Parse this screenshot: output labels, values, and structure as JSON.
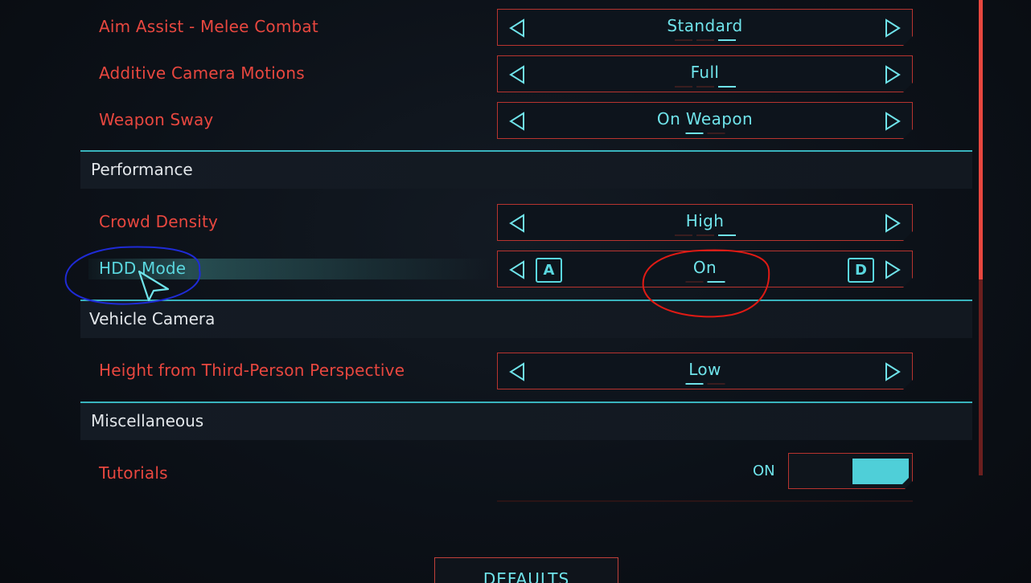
{
  "colors": {
    "label_red": "#e8473f",
    "value_cyan": "#6fe3ea",
    "section_line": "#39b3bd",
    "border_red": "#b8342f"
  },
  "rows": {
    "aim_assist": {
      "label": "Aim Assist - Melee Combat",
      "value": "Standard"
    },
    "camera_motions": {
      "label": "Additive Camera Motions",
      "value": "Full"
    },
    "weapon_sway": {
      "label": "Weapon Sway",
      "value": "On Weapon"
    },
    "crowd_density": {
      "label": "Crowd Density",
      "value": "High"
    },
    "hdd_mode": {
      "label": "HDD Mode",
      "value": "On",
      "key_left": "A",
      "key_right": "D"
    },
    "third_person_height": {
      "label": "Height from Third-Person Perspective",
      "value": "Low"
    },
    "tutorials": {
      "label": "Tutorials",
      "value": "ON"
    }
  },
  "sections": {
    "performance": "Performance",
    "vehicle_camera": "Vehicle Camera",
    "miscellaneous": "Miscellaneous"
  },
  "icons": {
    "left": "chevron-left-icon",
    "right": "chevron-right-icon",
    "cursor": "mouse-pointer-icon"
  },
  "buttons": {
    "defaults": "DEFAULTS"
  }
}
